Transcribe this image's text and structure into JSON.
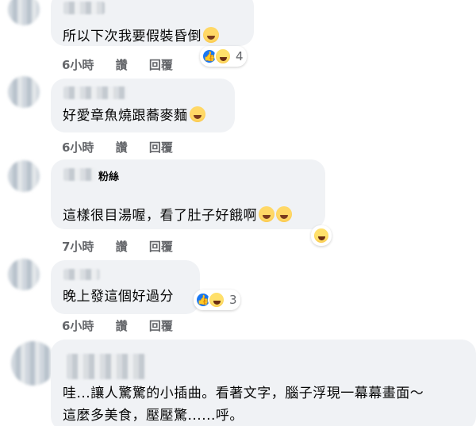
{
  "comments": [
    {
      "body": "所以下次我要假裝昏倒",
      "time": "6小時",
      "like_action": "讚",
      "reply_action": "回覆",
      "reaction_count": "4"
    },
    {
      "body": "好愛章魚燒跟蕎麥麵",
      "time": "6小時",
      "like_action": "讚",
      "reply_action": "回覆"
    },
    {
      "name_fragment": "粉絲",
      "body": "這樣很目湯喔，看了肚子好餓啊",
      "time": "7小時",
      "like_action": "讚",
      "reply_action": "回覆"
    },
    {
      "body": "晚上發這個好過分",
      "time": "6小時",
      "like_action": "讚",
      "reply_action": "回覆",
      "reaction_count": "3"
    },
    {
      "body_line1": "哇...讓人驚驚的小插曲。看著文字，腦子浮現一幕幕畫面～",
      "body_line2": "這麼多美食，壓壓驚......呼。"
    }
  ],
  "colors": {
    "bubble": "#f0f2f5",
    "meta_text": "#65676b",
    "like_blue": "#1877f2"
  }
}
